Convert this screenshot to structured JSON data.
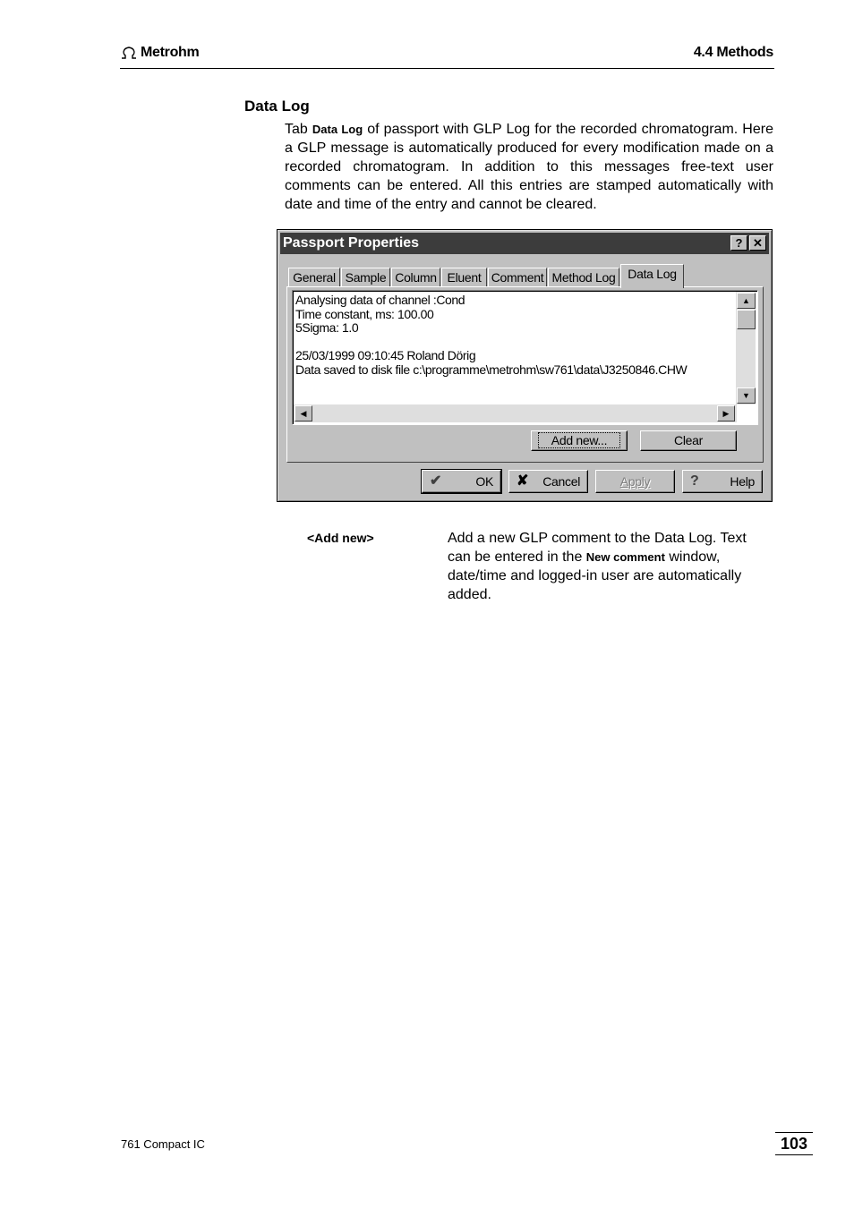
{
  "header": {
    "brand": "Metrohm",
    "section": "4.4 Methods"
  },
  "section_heading": "Data Log",
  "intro": {
    "prefix": "Tab ",
    "keyword": "Data Log",
    "rest": " of passport with GLP Log for the recorded chromatogram. Here a GLP message is automatically produced for every modification made on a recorded chromatogram. In addition to this messages free-text user comments can be entered. All this entries are stamped automatically with date and time of the entry and cannot be cleared."
  },
  "dialog": {
    "title": "Passport Properties",
    "help_glyph": "?",
    "close_glyph": "✕",
    "tabs": [
      "General",
      "Sample",
      "Column",
      "Eluent",
      "Comment",
      "Method Log",
      "Data Log"
    ],
    "active_tab": "Data Log",
    "log_lines": "Analysing data of channel :Cond\nTime constant, ms: 100.00\n5Sigma: 1.0\n\n25/03/1999 09:10:45 Roland Dörig\nData saved to disk file c:\\programme\\metrohm\\sw761\\data\\J3250846.CHW",
    "add_new_label": "Add new...",
    "clear_label": "Clear",
    "ok_label": "OK",
    "cancel_label": "Cancel",
    "apply_label": "Apply",
    "help_label": "Help"
  },
  "definition": {
    "term": "<Add new>",
    "desc_prefix": "Add a new GLP comment to the Data Log. Text can be entered in the ",
    "desc_keyword": "New comment",
    "desc_suffix": " window, date/time and logged-in user are automatically added."
  },
  "footer": {
    "product": "761 Compact IC",
    "page_number": "103"
  }
}
